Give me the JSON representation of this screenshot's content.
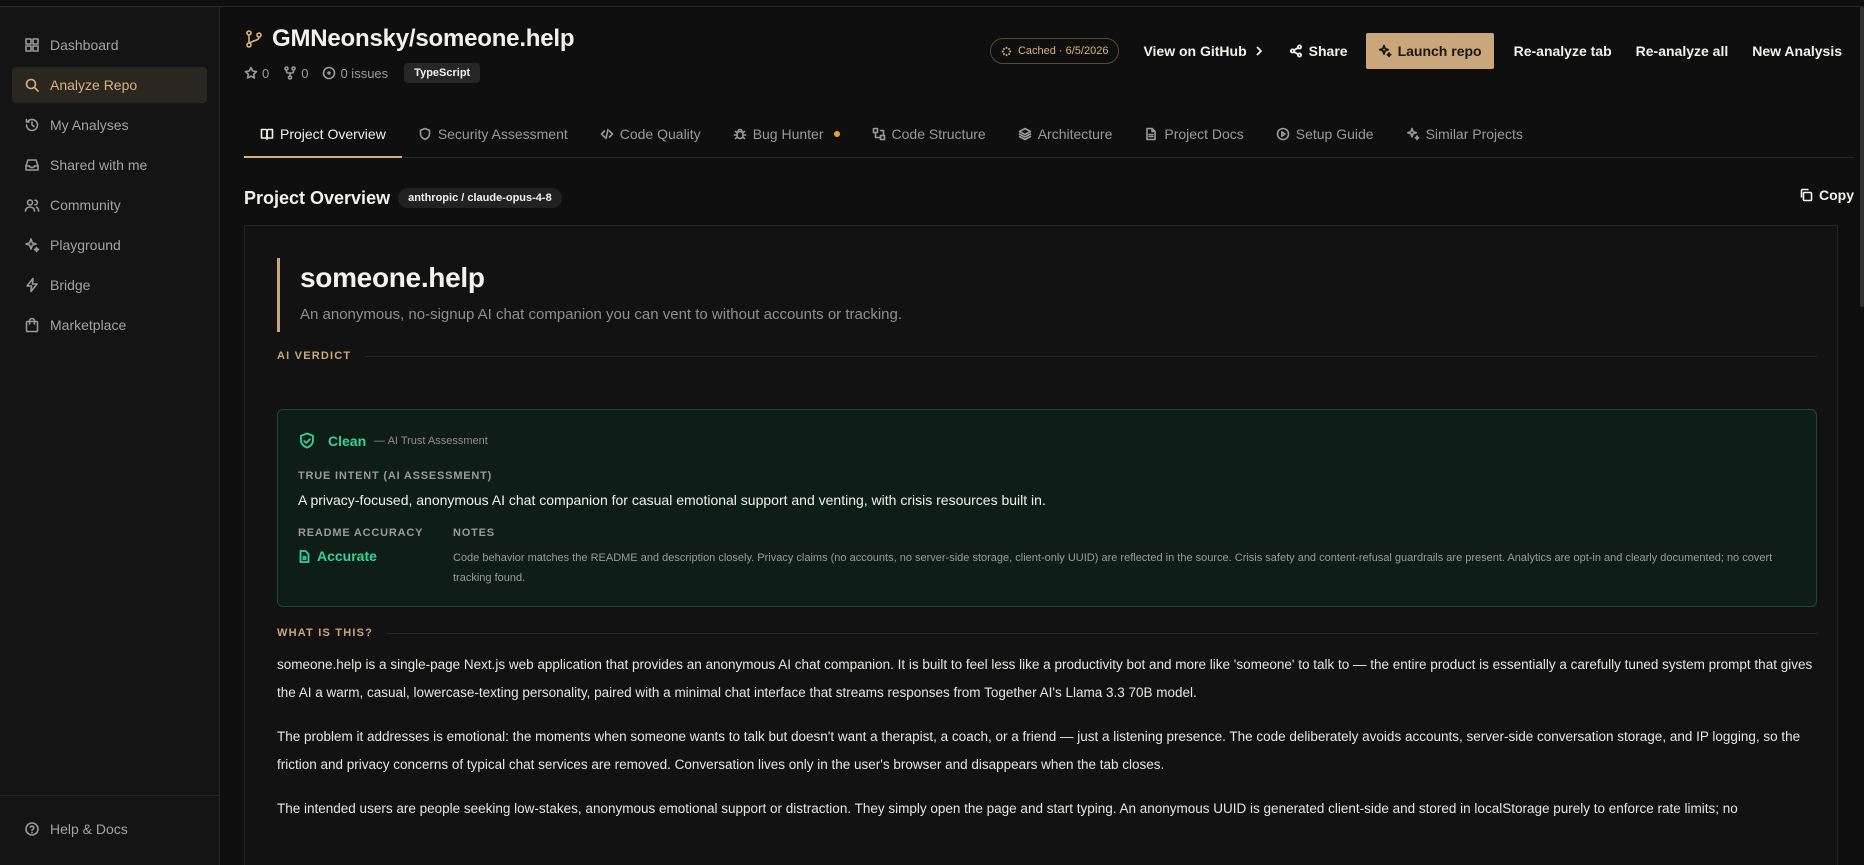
{
  "sidebar": {
    "items": [
      {
        "label": "Dashboard",
        "icon": "dashboard-icon"
      },
      {
        "label": "Analyze Repo",
        "icon": "search-icon",
        "active": true
      },
      {
        "label": "My Analyses",
        "icon": "history-icon"
      },
      {
        "label": "Shared with me",
        "icon": "inbox-icon"
      },
      {
        "label": "Community",
        "icon": "users-icon"
      },
      {
        "label": "Playground",
        "icon": "sparkles-icon"
      },
      {
        "label": "Bridge",
        "icon": "zap-icon"
      },
      {
        "label": "Marketplace",
        "icon": "shopping-bag-icon"
      }
    ],
    "footer": {
      "label": "Help & Docs",
      "icon": "help-icon"
    }
  },
  "header": {
    "repo": "GMNeonsky/someone.help",
    "stars": "0",
    "forks": "0",
    "issues": "0 issues",
    "language": "TypeScript",
    "cached": "Cached · 6/5/2026",
    "view_github": "View on GitHub",
    "share": "Share",
    "launch": "Launch repo",
    "reanalyze_tab": "Re-analyze tab",
    "reanalyze_all": "Re-analyze all",
    "new_analysis": "New Analysis"
  },
  "tabs": [
    {
      "label": "Project Overview",
      "icon": "book-icon",
      "active": true
    },
    {
      "label": "Security Assessment",
      "icon": "shield-icon"
    },
    {
      "label": "Code Quality",
      "icon": "code-icon"
    },
    {
      "label": "Bug Hunter",
      "icon": "bug-icon",
      "dot": true
    },
    {
      "label": "Code Structure",
      "icon": "structure-icon"
    },
    {
      "label": "Architecture",
      "icon": "layers-icon"
    },
    {
      "label": "Project Docs",
      "icon": "file-icon"
    },
    {
      "label": "Setup Guide",
      "icon": "play-circle-icon"
    },
    {
      "label": "Similar Projects",
      "icon": "sparkles-icon"
    }
  ],
  "section": {
    "title": "Project Overview",
    "model": "anthropic / claude-opus-4-8",
    "copy": "Copy"
  },
  "content": {
    "title": "someone.help",
    "tagline": "An anonymous, no-signup AI chat companion you can vent to without accounts or tracking.",
    "verdict_label": "AI VERDICT",
    "verdict": {
      "status": "Clean",
      "subtitle": "— AI Trust Assessment",
      "intent_label": "TRUE INTENT (AI ASSESSMENT)",
      "intent": "A privacy-focused, anonymous AI chat companion for casual emotional support and venting, with crisis resources built in.",
      "accuracy_label": "README ACCURACY",
      "accuracy": "Accurate",
      "notes_label": "NOTES",
      "notes": "Code behavior matches the README and description closely. Privacy claims (no accounts, no server-side storage, client-only UUID) are reflected in the source. Crisis safety and content-refusal guardrails are present. Analytics are opt-in and clearly documented; no covert tracking found."
    },
    "what_label": "WHAT IS THIS?",
    "paragraphs": [
      "someone.help is a single-page Next.js web application that provides an anonymous AI chat companion. It is built to feel less like a productivity bot and more like 'someone' to talk to — the entire product is essentially a carefully tuned system prompt that gives the AI a warm, casual, lowercase-texting personality, paired with a minimal chat interface that streams responses from Together AI's Llama 3.3 70B model.",
      "The problem it addresses is emotional: the moments when someone wants to talk but doesn't want a therapist, a coach, or a friend — just a listening presence. The code deliberately avoids accounts, server-side conversation storage, and IP logging, so the friction and privacy concerns of typical chat services are removed. Conversation lives only in the user's browser and disappears when the tab closes.",
      "The intended users are people seeking low-stakes, anonymous emotional support or distraction. They simply open the page and start typing. An anonymous UUID is generated client-side and stored in localStorage purely to enforce rate limits; no"
    ]
  },
  "colors": {
    "accent": "#c9a77a",
    "success": "#34d399",
    "background": "#0f0f0f"
  }
}
